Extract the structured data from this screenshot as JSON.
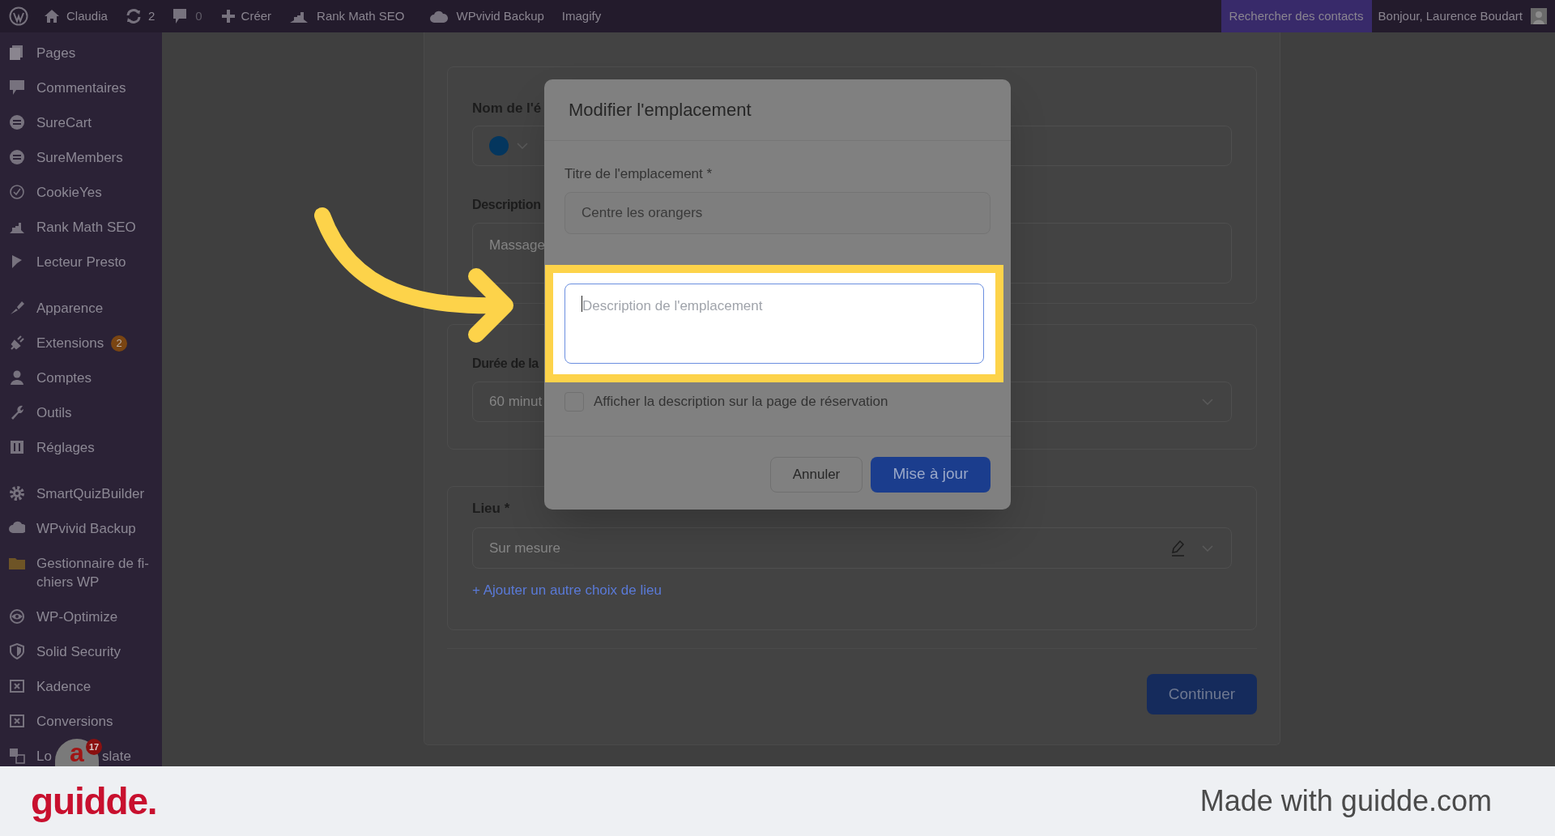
{
  "top_bar": {
    "site": "Claudia",
    "updates": "2",
    "comments": "0",
    "new": "Créer",
    "items": [
      "Rank Math SEO",
      "WPvivid Backup",
      "Imagify"
    ],
    "search_contacts": "Rechercher des contacts",
    "greeting": "Bonjour, Laurence Boudart"
  },
  "sidebar": {
    "groups": [
      [
        {
          "label": "Pages"
        },
        {
          "label": "Commentaires"
        },
        {
          "label": "SureCart"
        },
        {
          "label": "SureMembers"
        },
        {
          "label": "CookieYes"
        },
        {
          "label": "Rank Math SEO"
        },
        {
          "label": "Lecteur Presto"
        }
      ],
      [
        {
          "label": "Apparence"
        },
        {
          "label": "Extensions",
          "badge": "2"
        },
        {
          "label": "Comptes"
        },
        {
          "label": "Outils"
        },
        {
          "label": "Réglages"
        }
      ],
      [
        {
          "label": "SmartQuizBuilder"
        },
        {
          "label": "WPvivid Backup"
        },
        {
          "label": "Gestionnaire de fi-chiers WP"
        },
        {
          "label": "WP-Optimize"
        },
        {
          "label": "Solid Security"
        },
        {
          "label": "Kadence"
        },
        {
          "label": "Conversions"
        },
        {
          "label": "Lo",
          "label_end": "slate"
        }
      ]
    ],
    "widget": {
      "glyph": "a",
      "badge": "17"
    }
  },
  "form": {
    "name_label": "Nom de l'é",
    "description_label": "Description",
    "description_value": "Massage",
    "duration_label": "Durée de la",
    "duration_value": "60 minut",
    "location_label": "Lieu *",
    "location_value": "Sur mesure",
    "add_location": "+ Ajouter un autre choix de lieu",
    "continue": "Continuer"
  },
  "modal": {
    "title": "Modifier l'emplacement",
    "title_label": "Titre de l'emplacement *",
    "title_value": "Centre les orangers",
    "description_placeholder": "Description de l'emplacement",
    "show_description": {
      "label": "Afficher la description sur la page de réservation",
      "checked": false
    },
    "cancel": "Annuler",
    "submit": "Mise à jour"
  },
  "footer": {
    "logo": "guidde.",
    "text": "Made with guidde.com"
  }
}
